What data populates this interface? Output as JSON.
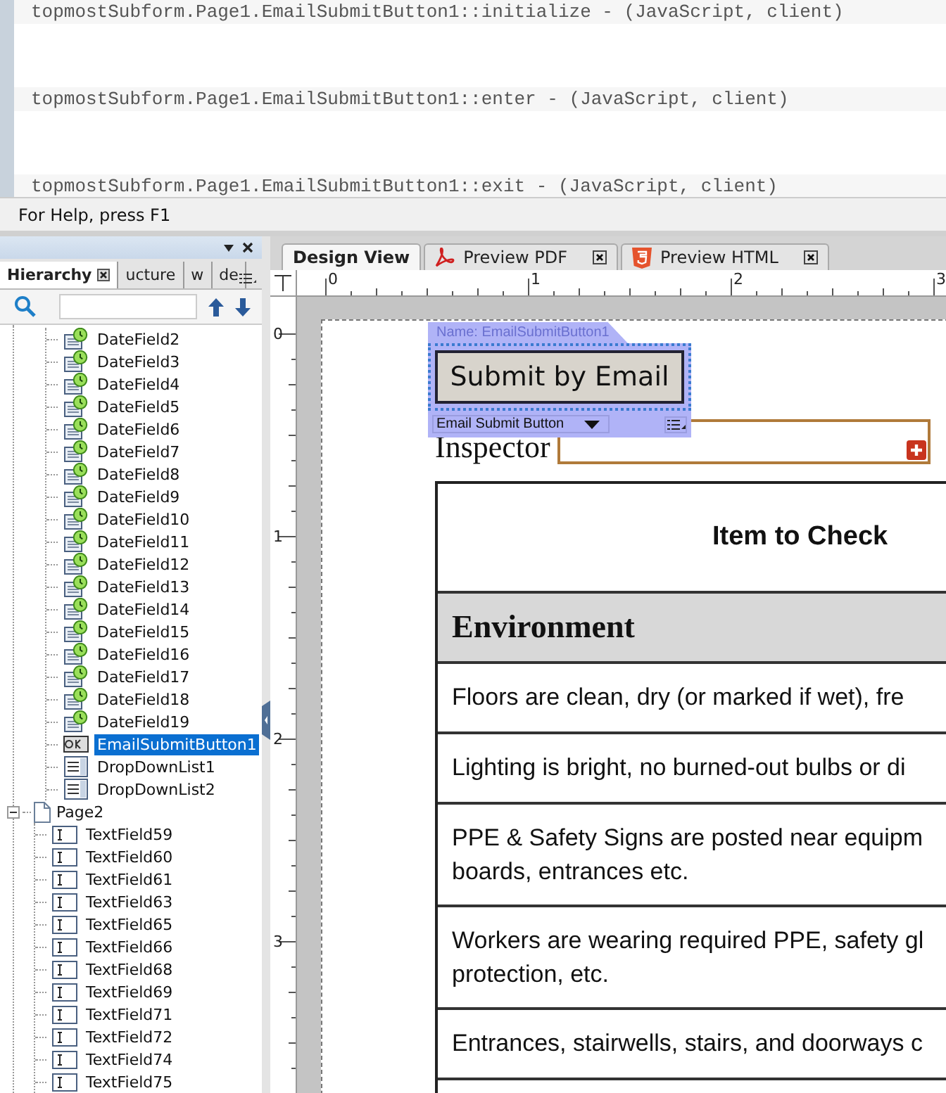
{
  "script_lines": [
    "topmostSubform.Page1.EmailSubmitButton1::initialize - (JavaScript, client)",
    "topmostSubform.Page1.EmailSubmitButton1::enter - (JavaScript, client)",
    "topmostSubform.Page1.EmailSubmitButton1::exit - (JavaScript, client)"
  ],
  "status_bar": "For Help, press F1",
  "hierarchy_panel": {
    "tabs": [
      {
        "label": "Hierarchy",
        "selected": true
      },
      {
        "label": "ucture",
        "selected": false
      },
      {
        "label": "w",
        "selected": false
      },
      {
        "label": "de",
        "selected": false
      }
    ],
    "tree": [
      {
        "kind": "hidden",
        "children": [
          {
            "label": "DateField2",
            "kind": "date",
            "selected": false
          },
          {
            "label": "DateField3",
            "kind": "date",
            "selected": false
          },
          {
            "label": "DateField4",
            "kind": "date",
            "selected": false
          },
          {
            "label": "DateField5",
            "kind": "date",
            "selected": false
          },
          {
            "label": "DateField6",
            "kind": "date",
            "selected": false
          },
          {
            "label": "DateField7",
            "kind": "date",
            "selected": false
          },
          {
            "label": "DateField8",
            "kind": "date",
            "selected": false
          },
          {
            "label": "DateField9",
            "kind": "date",
            "selected": false
          },
          {
            "label": "DateField10",
            "kind": "date",
            "selected": false
          },
          {
            "label": "DateField11",
            "kind": "date",
            "selected": false
          },
          {
            "label": "DateField12",
            "kind": "date",
            "selected": false
          },
          {
            "label": "DateField13",
            "kind": "date",
            "selected": false
          },
          {
            "label": "DateField14",
            "kind": "date",
            "selected": false
          },
          {
            "label": "DateField15",
            "kind": "date",
            "selected": false
          },
          {
            "label": "DateField16",
            "kind": "date",
            "selected": false
          },
          {
            "label": "DateField17",
            "kind": "date",
            "selected": false
          },
          {
            "label": "DateField18",
            "kind": "date",
            "selected": false
          },
          {
            "label": "DateField19",
            "kind": "date",
            "selected": false
          },
          {
            "label": "EmailSubmitButton1",
            "kind": "button",
            "selected": true
          },
          {
            "label": "DropDownList1",
            "kind": "dropdown",
            "selected": false
          },
          {
            "label": "DropDownList2",
            "kind": "dropdown",
            "selected": false
          }
        ]
      },
      {
        "label": "Page2",
        "kind": "page",
        "selected": false,
        "expanded": true,
        "children": [
          {
            "label": "TextField59",
            "kind": "text",
            "selected": false
          },
          {
            "label": "TextField60",
            "kind": "text",
            "selected": false
          },
          {
            "label": "TextField61",
            "kind": "text",
            "selected": false
          },
          {
            "label": "TextField63",
            "kind": "text",
            "selected": false
          },
          {
            "label": "TextField65",
            "kind": "text",
            "selected": false
          },
          {
            "label": "TextField66",
            "kind": "text",
            "selected": false
          },
          {
            "label": "TextField68",
            "kind": "text",
            "selected": false
          },
          {
            "label": "TextField69",
            "kind": "text",
            "selected": false
          },
          {
            "label": "TextField71",
            "kind": "text",
            "selected": false
          },
          {
            "label": "TextField72",
            "kind": "text",
            "selected": false
          },
          {
            "label": "TextField74",
            "kind": "text",
            "selected": false
          },
          {
            "label": "TextField75",
            "kind": "text",
            "selected": false
          }
        ]
      }
    ]
  },
  "editor_tabs": [
    {
      "label": "Design View",
      "selected": true
    },
    {
      "label": "Preview PDF",
      "selected": false
    },
    {
      "label": "Preview HTML",
      "selected": false
    }
  ],
  "ruler": {
    "horizontal": [
      "0",
      "1",
      "2",
      "3"
    ],
    "vertical": [
      "0",
      "1",
      "2",
      "3"
    ]
  },
  "selection": {
    "name_label": "Name: EmailSubmitButton1",
    "button_caption": "Submit by Email",
    "object_type": "Email Submit Button"
  },
  "form": {
    "field_label": "Inspector",
    "table": {
      "header": "Item to Check",
      "section": "Environment",
      "rows": [
        [
          "Floors are clean, dry (or marked if wet), fre"
        ],
        [
          "Lighting is bright, no burned-out bulbs or di"
        ],
        [
          "PPE & Safety Signs are posted near equipm",
          "boards, entrances etc."
        ],
        [
          "Workers are wearing required PPE, safety gl",
          "protection, etc."
        ],
        [
          "Entrances, stairwells, stairs, and doorways c"
        ]
      ]
    }
  }
}
